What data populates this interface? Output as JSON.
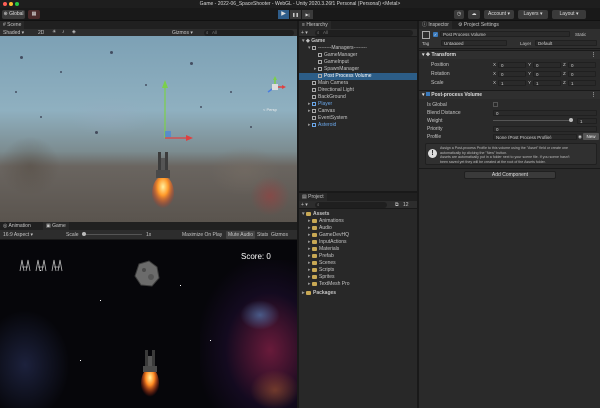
{
  "window": {
    "title": "Game - 2022-06_SpaceShooter - WebGL - Unity 2020.3.26f1 Personal (Personal) <Metal>"
  },
  "toolbar": {
    "global_label": "Global",
    "account_label": "Account",
    "layers_label": "Layers",
    "layout_label": "Layout",
    "play_icon": "▶",
    "pause_icon": "❚❚",
    "step_icon": "▶|"
  },
  "scene": {
    "tab_label": "Scene",
    "shading": "Shaded",
    "mode_2d": "2D",
    "gizmos_label": "Gizmos",
    "search_placeholder": "All",
    "persp_label": "< Persp"
  },
  "game": {
    "tab_animation": "Animation",
    "tab_game": "Game",
    "display": "Display 1",
    "aspect": "16:9 Aspect",
    "scale_label": "Scale",
    "scale_value": "1x",
    "maximize": "Maximize On Play",
    "mute": "Mute Audio",
    "stats": "Stats",
    "gizmos": "Gizmos",
    "score": "Score: 0"
  },
  "hierarchy": {
    "tab_label": "Hierarchy",
    "search_placeholder": "All",
    "root": "Game",
    "items": [
      {
        "label": "--------Managers--------",
        "indent": 1,
        "selected": false,
        "arrow": "▾",
        "blue": false
      },
      {
        "label": "GameManager",
        "indent": 2,
        "selected": false,
        "arrow": "",
        "blue": false
      },
      {
        "label": "GameInput",
        "indent": 2,
        "selected": false,
        "arrow": "",
        "blue": false
      },
      {
        "label": "SpawnManager",
        "indent": 2,
        "selected": false,
        "arrow": "▸",
        "blue": false
      },
      {
        "label": "Post Process Volume",
        "indent": 2,
        "selected": true,
        "arrow": "",
        "blue": false
      },
      {
        "label": "Main Camera",
        "indent": 1,
        "selected": false,
        "arrow": "",
        "blue": false
      },
      {
        "label": "Directional Light",
        "indent": 1,
        "selected": false,
        "arrow": "",
        "blue": false
      },
      {
        "label": "BackGround",
        "indent": 1,
        "selected": false,
        "arrow": "",
        "blue": false
      },
      {
        "label": "Player",
        "indent": 1,
        "selected": false,
        "arrow": "▸",
        "blue": true
      },
      {
        "label": "Canvas",
        "indent": 1,
        "selected": false,
        "arrow": "▸",
        "blue": false
      },
      {
        "label": "EventSystem",
        "indent": 1,
        "selected": false,
        "arrow": "",
        "blue": false
      },
      {
        "label": "Asteroid",
        "indent": 1,
        "selected": false,
        "arrow": "▸",
        "blue": true
      }
    ]
  },
  "project": {
    "tab_label": "Project",
    "count": "12",
    "assets_label": "Assets",
    "folders": [
      "Animations",
      "Audio",
      "GameDevHQ",
      "InputActions",
      "Materials",
      "Prefab",
      "Scenes",
      "Scripts",
      "Sprites",
      "TextMesh Pro"
    ],
    "packages_label": "Packages"
  },
  "inspector": {
    "tab_inspector": "Inspector",
    "tab_settings": "Project Settings",
    "object_name": "Post Process Volume",
    "static_label": "Static",
    "tag_label": "Tag",
    "tag_value": "Untagged",
    "layer_label": "Layer",
    "layer_value": "Default",
    "transform_title": "Transform",
    "position_label": "Position",
    "rotation_label": "Rotation",
    "scale_label": "Scale",
    "position": {
      "x": "0",
      "y": "0",
      "z": "0"
    },
    "rotation": {
      "x": "0",
      "y": "0",
      "z": "0"
    },
    "scale": {
      "x": "1",
      "y": "1",
      "z": "1"
    },
    "ppv_title": "Post-process Volume",
    "is_global_label": "Is Global",
    "blend_label": "Blend Distance",
    "blend_value": "0",
    "weight_label": "Weight",
    "weight_value": "1",
    "weight_fraction": 1.0,
    "priority_label": "Priority",
    "priority_value": "0",
    "profile_label": "Profile",
    "profile_value": "None (Post Process Profile)",
    "new_label": "New",
    "help_line1": "Assign a Post-process Profile to this volume using the \"Asset\" field or create one",
    "help_line2": "automatically by clicking the \"New\" button.",
    "help_line3": "Assets are automatically put in a folder next to your scene file. If you scene hasn't",
    "help_line4": "been saved yet they will be created at the root of the Assets folder.",
    "add_component": "Add Component",
    "x_axis": "X",
    "y_axis": "Y",
    "z_axis": "Z"
  },
  "colors": {
    "selection": "#2c5d87",
    "prefab_blue": "#6aa6e8",
    "accent": "#3a79bb"
  }
}
